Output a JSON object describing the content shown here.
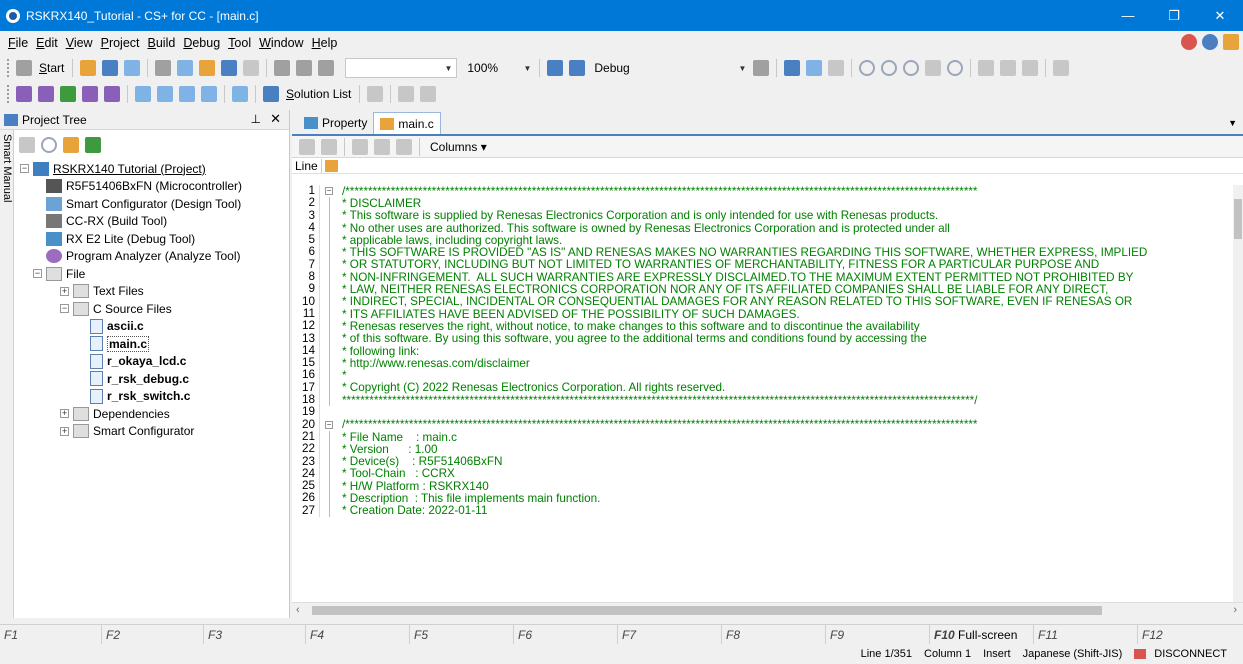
{
  "window": {
    "title": "RSKRX140_Tutorial - CS+ for CC - [main.c]",
    "minimize": "—",
    "restore": "❐",
    "close": "✕"
  },
  "menu": [
    "File",
    "Edit",
    "View",
    "Project",
    "Build",
    "Debug",
    "Tool",
    "Window",
    "Help"
  ],
  "toolbar1": {
    "start_label": "Start",
    "zoom_value": "100%",
    "build_mode": "Debug"
  },
  "toolbar2": {
    "solution_list_label": "Solution List"
  },
  "project_tree": {
    "title": "Project Tree",
    "side_tab": "Smart Manual",
    "project": "RSKRX140 Tutorial (Project)",
    "items": [
      "R5F51406BxFN (Microcontroller)",
      "Smart Configurator (Design Tool)",
      "CC-RX (Build Tool)",
      "RX E2 Lite (Debug Tool)",
      "Program Analyzer (Analyze Tool)"
    ],
    "file_folder": "File",
    "text_files": "Text Files",
    "c_source_files": "C Source Files",
    "c_files": [
      "ascii.c",
      "main.c",
      "r_okaya_lcd.c",
      "r_rsk_debug.c",
      "r_rsk_switch.c"
    ],
    "dependencies": "Dependencies",
    "smart_configurator": "Smart Configurator"
  },
  "editor": {
    "tabs": [
      "Property",
      "main.c"
    ],
    "columns_label": "Columns",
    "line_header": "Line",
    "lines": [
      "/*******************************************************************************************************************************************",
      "* DISCLAIMER",
      "* This software is supplied by Renesas Electronics Corporation and is only intended for use with Renesas products.",
      "* No other uses are authorized. This software is owned by Renesas Electronics Corporation and is protected under all",
      "* applicable laws, including copyright laws.",
      "* THIS SOFTWARE IS PROVIDED \"AS IS\" AND RENESAS MAKES NO WARRANTIES REGARDING THIS SOFTWARE, WHETHER EXPRESS, IMPLIED",
      "* OR STATUTORY, INCLUDING BUT NOT LIMITED TO WARRANTIES OF MERCHANTABILITY, FITNESS FOR A PARTICULAR PURPOSE AND",
      "* NON-INFRINGEMENT.  ALL SUCH WARRANTIES ARE EXPRESSLY DISCLAIMED.TO THE MAXIMUM EXTENT PERMITTED NOT PROHIBITED BY",
      "* LAW, NEITHER RENESAS ELECTRONICS CORPORATION NOR ANY OF ITS AFFILIATED COMPANIES SHALL BE LIABLE FOR ANY DIRECT,",
      "* INDIRECT, SPECIAL, INCIDENTAL OR CONSEQUENTIAL DAMAGES FOR ANY REASON RELATED TO THIS SOFTWARE, EVEN IF RENESAS OR",
      "* ITS AFFILIATES HAVE BEEN ADVISED OF THE POSSIBILITY OF SUCH DAMAGES.",
      "* Renesas reserves the right, without notice, to make changes to this software and to discontinue the availability",
      "* of this software. By using this software, you agree to the additional terms and conditions found by accessing the",
      "* following link:",
      "* http://www.renesas.com/disclaimer",
      "*",
      "* Copyright (C) 2022 Renesas Electronics Corporation. All rights reserved.",
      "*******************************************************************************************************************************************/",
      "",
      "/*******************************************************************************************************************************************",
      "* File Name    : main.c",
      "* Version      : 1.00",
      "* Device(s)    : R5F51406BxFN",
      "* Tool-Chain   : CCRX",
      "* H/W Platform : RSKRX140",
      "* Description  : This file implements main function.",
      "* Creation Date: 2022-01-11"
    ]
  },
  "fkeys": [
    "F1",
    "F2",
    "F3",
    "F4",
    "F5",
    "F6",
    "F7",
    "F8",
    "F9",
    "F10",
    "Full-screen",
    "F11",
    "F12"
  ],
  "status": {
    "line": "Line 1/351",
    "column": "Column 1",
    "mode": "Insert",
    "encoding": "Japanese (Shift-JIS)",
    "connection": "DISCONNECT"
  }
}
